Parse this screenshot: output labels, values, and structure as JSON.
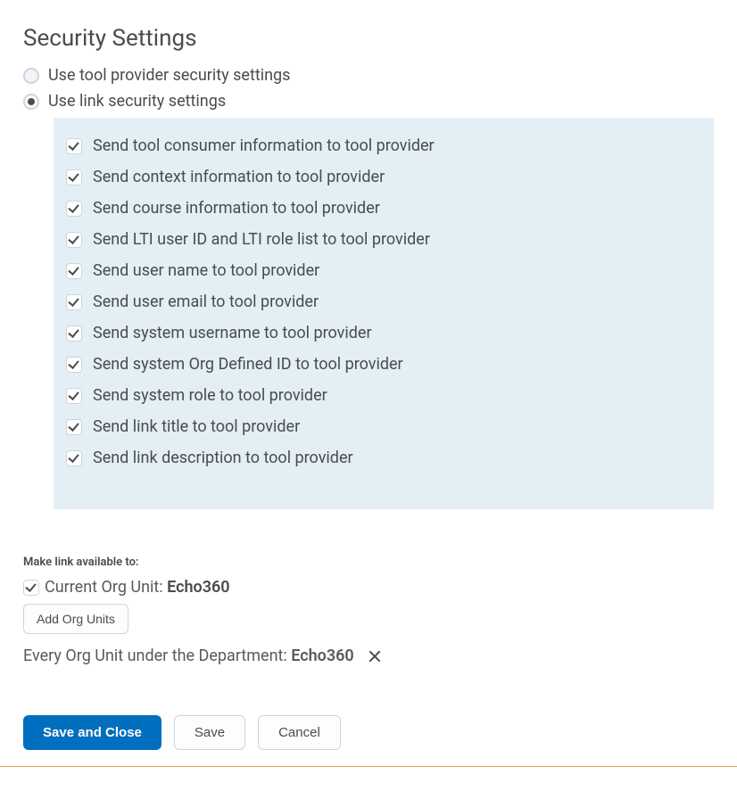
{
  "title": "Security Settings",
  "radios": {
    "provider": "Use tool provider security settings",
    "link": "Use link security settings",
    "selected": "link"
  },
  "checkboxes": [
    {
      "label": "Send tool consumer information to tool provider",
      "checked": true
    },
    {
      "label": "Send context information to tool provider",
      "checked": true
    },
    {
      "label": "Send course information to tool provider",
      "checked": true
    },
    {
      "label": "Send LTI user ID and LTI role list to tool provider",
      "checked": true
    },
    {
      "label": "Send user name to tool provider",
      "checked": true
    },
    {
      "label": "Send user email to tool provider",
      "checked": true
    },
    {
      "label": "Send system username to tool provider",
      "checked": true
    },
    {
      "label": "Send system Org Defined ID to tool provider",
      "checked": true
    },
    {
      "label": "Send system role to tool provider",
      "checked": true
    },
    {
      "label": "Send link title to tool provider",
      "checked": true
    },
    {
      "label": "Send link description to tool provider",
      "checked": true
    }
  ],
  "availability": {
    "header": "Make link available to:",
    "current_org_label": "Current Org Unit: ",
    "current_org_name": "Echo360",
    "current_org_checked": true,
    "add_org_units": "Add Org Units",
    "dept_prefix": "Every Org Unit under the Department: ",
    "dept_name": "Echo360"
  },
  "footer": {
    "save_close": "Save and Close",
    "save": "Save",
    "cancel": "Cancel"
  }
}
